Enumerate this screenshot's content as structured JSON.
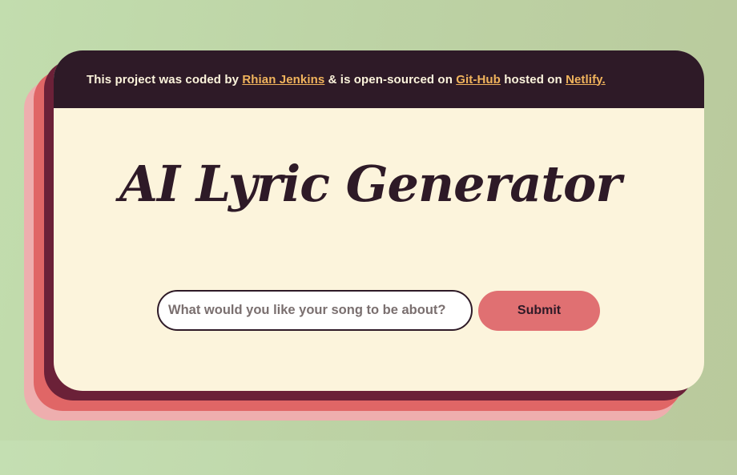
{
  "header": {
    "text_prefix": "This project was coded by ",
    "author_link": "Rhian Jenkins",
    "text_middle": " & is open-sourced on ",
    "github_link": "Git-Hub",
    "text_hosted": " hosted on ",
    "netlify_link": "Netlify."
  },
  "main": {
    "title": "AI Lyric Generator"
  },
  "form": {
    "input_placeholder": "What would you like your song to be about?",
    "input_value": "",
    "submit_label": "Submit"
  },
  "colors": {
    "background": "#c0d8ab",
    "card": "#fcf4dc",
    "header_bg": "#2e1a27",
    "link": "#f0b35c",
    "layer_dark": "#6b2138",
    "layer_mid": "#e06666",
    "layer_light": "#eeaeae",
    "button": "#e07072"
  }
}
